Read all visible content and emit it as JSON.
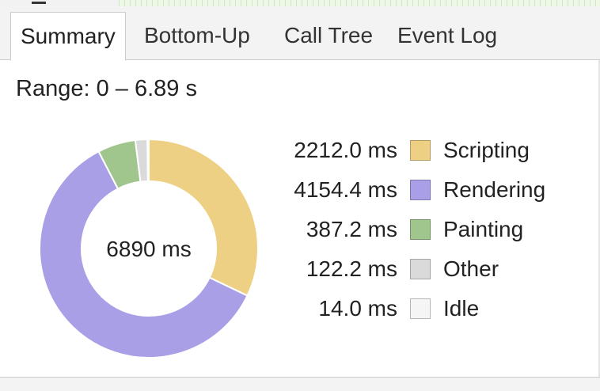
{
  "tabs": [
    {
      "label": "Summary",
      "selected": true
    },
    {
      "label": "Bottom-Up",
      "selected": false
    },
    {
      "label": "Call Tree",
      "selected": false
    },
    {
      "label": "Event Log",
      "selected": false
    }
  ],
  "summary": {
    "range_text": "Range: 0 – 6.89 s",
    "total_label": "6890 ms"
  },
  "chart_data": {
    "type": "pie",
    "title": "",
    "total_label": "6890 ms",
    "slices": [
      {
        "label": "Scripting",
        "value": 2212.0,
        "value_text": "2212.0 ms",
        "color": "#eed084"
      },
      {
        "label": "Rendering",
        "value": 4154.4,
        "value_text": "4154.4 ms",
        "color": "#a99fe6"
      },
      {
        "label": "Painting",
        "value": 387.2,
        "value_text": "387.2 ms",
        "color": "#a0c58d"
      },
      {
        "label": "Other",
        "value": 122.2,
        "value_text": "122.2 ms",
        "color": "#dadada"
      },
      {
        "label": "Idle",
        "value": 14.0,
        "value_text": "14.0 ms",
        "color": "#f5f5f5"
      }
    ],
    "legend_position": "right"
  }
}
